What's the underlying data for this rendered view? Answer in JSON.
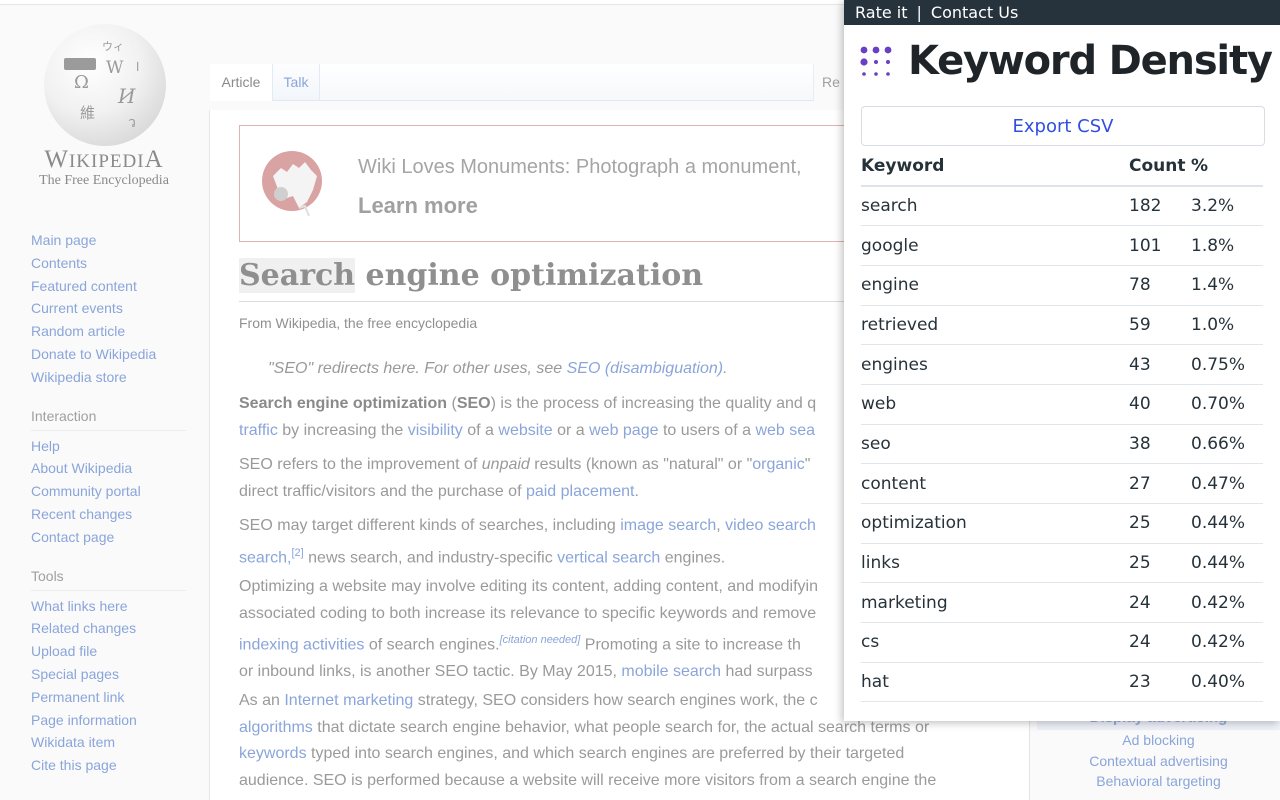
{
  "wikipedia": {
    "logo": {
      "wordmark": "WIKIPEDIA",
      "tagline": "The Free Encyclopedia"
    },
    "nav": {
      "main": [
        "Main page",
        "Contents",
        "Featured content",
        "Current events",
        "Random article",
        "Donate to Wikipedia",
        "Wikipedia store"
      ],
      "interaction_title": "Interaction",
      "interaction": [
        "Help",
        "About Wikipedia",
        "Community portal",
        "Recent changes",
        "Contact page"
      ],
      "tools_title": "Tools",
      "tools": [
        "What links here",
        "Related changes",
        "Upload file",
        "Special pages",
        "Permanent link",
        "Page information",
        "Wikidata item",
        "Cite this page"
      ]
    },
    "tabs": {
      "article": "Article",
      "talk": "Talk",
      "read_partial": "Re"
    },
    "banner": {
      "text": "Wiki Loves Monuments: Photograph a monument,",
      "learn_more": "Learn more"
    },
    "title": {
      "highlighted": "Search",
      "rest": " engine optimization"
    },
    "from": "From Wikipedia, the free encyclopedia",
    "hatnote": {
      "text": "\"SEO\" redirects here. For other uses, see ",
      "link": "SEO (disambiguation)",
      "end": "."
    },
    "paragraphs": {
      "p1": {
        "l1_bold1": "Search engine optimization",
        "l1_t1": " (",
        "l1_bold2": "SEO",
        "l1_t2": ") is the process of increasing the quality and q",
        "l2_a1": "traffic",
        "l2_t1": " by increasing the ",
        "l2_a2": "visibility",
        "l2_t2": " of a ",
        "l2_a3": "website",
        "l2_t3": " or a ",
        "l2_a4": "web page",
        "l2_t4": " to users of a ",
        "l2_a5": "web sea"
      },
      "p2": {
        "l1_t1": "SEO refers to the improvement of ",
        "l1_i": "unpaid",
        "l1_t2": " results (known as \"natural\" or \"",
        "l1_a1": "organic",
        "l1_t3": "\"",
        "l2_t1": "direct traffic/visitors and the purchase of ",
        "l2_a1": "paid placement",
        "l2_t2": "."
      },
      "p3": {
        "l1_t1": "SEO may target different kinds of searches, including ",
        "l1_a1": "image search",
        "l1_t2": ", ",
        "l1_a2": "video search",
        "l2_a1": "search,",
        "l2_sup": "[2]",
        "l2_t1": " news search, and industry-specific ",
        "l2_a2": "vertical search",
        "l2_t2": " engines."
      },
      "p4": {
        "l1": "Optimizing a website may involve editing its content, adding content, and modifyin",
        "l2": "associated coding to both increase its relevance to specific keywords and remove",
        "l3_a1": "indexing activities",
        "l3_t1": " of search engines.",
        "l3_sup": "[citation needed]",
        "l3_t2": " Promoting a site to increase th",
        "l4_t1": "or inbound links, is another SEO tactic. By May 2015, ",
        "l4_a1": "mobile search",
        "l4_t2": " had surpass"
      },
      "p5": {
        "l1_t1": "As an ",
        "l1_a1": "Internet marketing",
        "l1_t2": " strategy, SEO considers how search engines work, the c",
        "l2_a1": "algorithms",
        "l2_t1": " that dictate search engine behavior, what people search for, the actual search terms or",
        "l3_a1": "keywords",
        "l3_t1": " typed into search engines, and which search engines are preferred by their targeted",
        "l4": "audience. SEO is performed because a website will receive more visitors from a search engine the"
      }
    },
    "sidebox": {
      "header": "Display advertising",
      "links": [
        "Ad blocking",
        "Contextual advertising",
        "Behavioral targeting"
      ]
    }
  },
  "extension": {
    "topbar": {
      "rate": "Rate it",
      "separator": "|",
      "contact": "Contact Us"
    },
    "brand": {
      "title": "Keyword Density",
      "icon": "dots-grid-icon",
      "accent_color": "#6a3fc4"
    },
    "export_label": "Export CSV",
    "export_color": "#2f4fe0",
    "table": {
      "headers": {
        "keyword": "Keyword",
        "count": "Count",
        "percent": "%"
      },
      "rows": [
        {
          "keyword": "search",
          "count": "182",
          "percent": "3.2%"
        },
        {
          "keyword": "google",
          "count": "101",
          "percent": "1.8%"
        },
        {
          "keyword": "engine",
          "count": "78",
          "percent": "1.4%"
        },
        {
          "keyword": "retrieved",
          "count": "59",
          "percent": "1.0%"
        },
        {
          "keyword": "engines",
          "count": "43",
          "percent": "0.75%"
        },
        {
          "keyword": "web",
          "count": "40",
          "percent": "0.70%"
        },
        {
          "keyword": "seo",
          "count": "38",
          "percent": "0.66%"
        },
        {
          "keyword": "content",
          "count": "27",
          "percent": "0.47%"
        },
        {
          "keyword": "optimization",
          "count": "25",
          "percent": "0.44%"
        },
        {
          "keyword": "links",
          "count": "25",
          "percent": "0.44%"
        },
        {
          "keyword": "marketing",
          "count": "24",
          "percent": "0.42%"
        },
        {
          "keyword": "cs",
          "count": "24",
          "percent": "0.42%"
        },
        {
          "keyword": "hat",
          "count": "23",
          "percent": "0.40%"
        }
      ]
    }
  }
}
